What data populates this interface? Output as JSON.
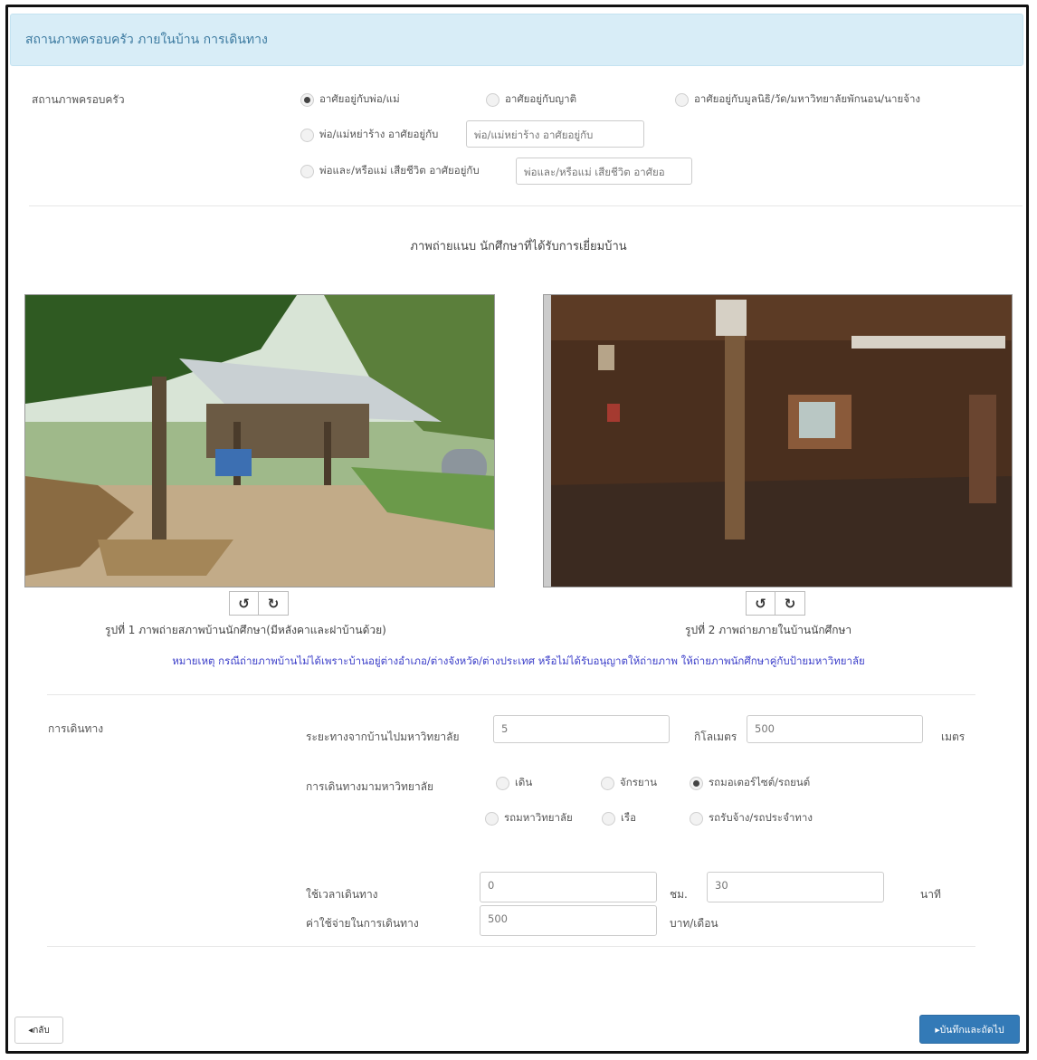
{
  "header": {
    "title": "สถานภาพครอบครัว ภายในบ้าน การเดินทาง"
  },
  "family": {
    "label": "สถานภาพครอบครัว",
    "options": [
      {
        "label": "อาศัยอยู่กับพ่อ/แม่",
        "selected": true
      },
      {
        "label": "อาศัยอยู่กับญาติ",
        "selected": false
      },
      {
        "label": "อาศัยอยู่กับมูลนิธิ/วัด/มหาวิทยาลัยพักนอน/นายจ้าง",
        "selected": false
      },
      {
        "label": "พ่อ/แม่หย่าร้าง อาศัยอยู่กับ",
        "selected": false
      },
      {
        "label": "พ่อและ/หรือแม่ เสียชีวิต อาศัยอยู่กับ",
        "selected": false
      }
    ],
    "divorced_placeholder": "พ่อ/แม่หย่าร้าง อาศัยอยู่กับ",
    "deceased_placeholder": "พ่อและ/หรือแม่ เสียชีวิต อาศัยอ"
  },
  "photos": {
    "title": "ภาพถ่ายแนบ นักศึกษาที่ได้รับการเยี่ยมบ้าน",
    "rotate_left_icon": "↺",
    "rotate_right_icon": "↻",
    "caption1": "รูปที่ 1 ภาพถ่ายสภาพบ้านนักศึกษา(มีหลังคาและฝาบ้านด้วย)",
    "caption2": "รูปที่ 2 ภาพถ่ายภายในบ้านนักศึกษา",
    "note": "หมายเหตุ กรณีถ่ายภาพบ้านไม่ได้เพราะบ้านอยู่ต่างอำเภอ/ต่างจังหวัด/ต่างประเทศ หรือไม่ได้รับอนุญาตให้ถ่ายภาพ ให้ถ่ายภาพนักศึกษาคู่กับป้ายมหาวิทยาลัย"
  },
  "travel": {
    "label": "การเดินทาง",
    "distance_label": "ระยะทางจากบ้านไปมหาวิทยาลัย",
    "distance_km": "5",
    "km_unit": "กิโลเมตร",
    "distance_m": "500",
    "m_unit": "เมตร",
    "mode_label": "การเดินทางมามหาวิทยาลัย",
    "modes": [
      {
        "label": "เดิน",
        "selected": false
      },
      {
        "label": "จักรยาน",
        "selected": false
      },
      {
        "label": "รถมอเตอร์ไซต์/รถยนต์",
        "selected": true
      },
      {
        "label": "รถมหาวิทยาลัย",
        "selected": false
      },
      {
        "label": "เรือ",
        "selected": false
      },
      {
        "label": "รถรับจ้าง/รถประจำทาง",
        "selected": false
      }
    ],
    "time_label": "ใช้เวลาเดินทาง",
    "time_hours": "0",
    "hours_unit": "ชม.",
    "time_minutes": "30",
    "minutes_unit": "นาที",
    "cost_label": "ค่าใช้จ่ายในการเดินทาง",
    "cost_value": "500",
    "cost_unit": "บาท/เดือน"
  },
  "footer": {
    "back_label": "◂กลับ",
    "save_label": "▸บันทึกและถัดไป"
  },
  "colors": {
    "header_bg": "#d8edf7",
    "header_text": "#3d7ba1",
    "note": "#3b3ec9",
    "primary": "#337ab7"
  }
}
